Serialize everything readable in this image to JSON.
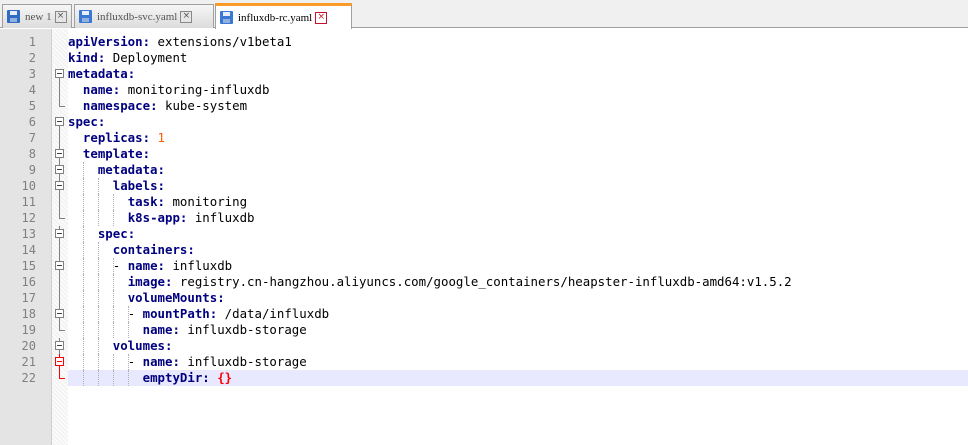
{
  "tabs": [
    {
      "title": "new 1",
      "state": "unsaved",
      "active": false
    },
    {
      "title": "influxdb-svc.yaml",
      "state": "saved",
      "active": false
    },
    {
      "title": "influxdb-rc.yaml",
      "state": "saved",
      "active": true
    }
  ],
  "tab_close_glyph": "×",
  "editor": {
    "current_line": 22,
    "lines": [
      {
        "n": "1",
        "indent": 0,
        "key": "apiVersion",
        "sep": ": ",
        "val": "extensions/v1beta1"
      },
      {
        "n": "2",
        "indent": 0,
        "key": "kind",
        "sep": ": ",
        "val": "Deployment"
      },
      {
        "n": "3",
        "indent": 0,
        "key": "metadata",
        "sep": ":",
        "val": ""
      },
      {
        "n": "4",
        "indent": 2,
        "key": "name",
        "sep": ": ",
        "val": "monitoring-influxdb"
      },
      {
        "n": "5",
        "indent": 2,
        "key": "namespace",
        "sep": ": ",
        "val": "kube-system"
      },
      {
        "n": "6",
        "indent": 0,
        "key": "spec",
        "sep": ":",
        "val": ""
      },
      {
        "n": "7",
        "indent": 2,
        "key": "replicas",
        "sep": ": ",
        "num": "1"
      },
      {
        "n": "8",
        "indent": 2,
        "key": "template",
        "sep": ":",
        "val": ""
      },
      {
        "n": "9",
        "indent": 4,
        "key": "metadata",
        "sep": ":",
        "val": ""
      },
      {
        "n": "10",
        "indent": 6,
        "key": "labels",
        "sep": ":",
        "val": ""
      },
      {
        "n": "11",
        "indent": 8,
        "key": "task",
        "sep": ": ",
        "val": "monitoring"
      },
      {
        "n": "12",
        "indent": 8,
        "key": "k8s-app",
        "sep": ": ",
        "val": "influxdb"
      },
      {
        "n": "13",
        "indent": 4,
        "key": "spec",
        "sep": ":",
        "val": ""
      },
      {
        "n": "14",
        "indent": 6,
        "key": "containers",
        "sep": ":",
        "val": ""
      },
      {
        "n": "15",
        "indent": 6,
        "dash": "- ",
        "key": "name",
        "sep": ": ",
        "val": "influxdb"
      },
      {
        "n": "16",
        "indent": 8,
        "key": "image",
        "sep": ": ",
        "val": "registry.cn-hangzhou.aliyuncs.com/google_containers/heapster-influxdb-amd64:v1.5.2"
      },
      {
        "n": "17",
        "indent": 8,
        "key": "volumeMounts",
        "sep": ":",
        "val": ""
      },
      {
        "n": "18",
        "indent": 8,
        "dash": "- ",
        "key": "mountPath",
        "sep": ": ",
        "val": "/data/influxdb"
      },
      {
        "n": "19",
        "indent": 10,
        "key": "name",
        "sep": ": ",
        "val": "influxdb-storage"
      },
      {
        "n": "20",
        "indent": 6,
        "key": "volumes",
        "sep": ":",
        "val": ""
      },
      {
        "n": "21",
        "indent": 8,
        "dash": "- ",
        "key": "name",
        "sep": ": ",
        "val": "influxdb-storage"
      },
      {
        "n": "22",
        "indent": 10,
        "key": "emptyDir",
        "sep": ": ",
        "brace": "{}"
      }
    ]
  },
  "colors": {
    "key": "#000080",
    "number": "#ff5a00",
    "brace": "#ff0000",
    "active_tab_accent": "#fa9b28",
    "current_line_bg": "#e8e8ff",
    "fold_active": "#ff0000"
  }
}
